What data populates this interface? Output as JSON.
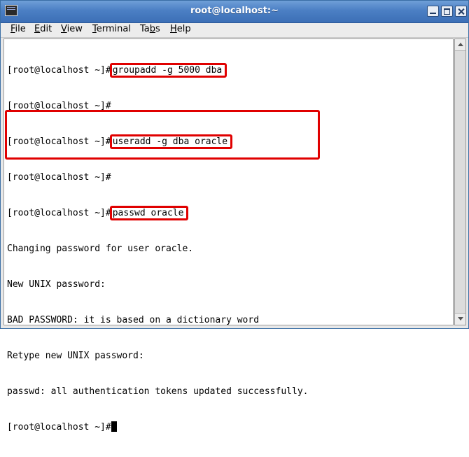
{
  "window": {
    "title": "root@localhost:~"
  },
  "menu": [
    {
      "pre": "",
      "mn": "F",
      "post": "ile"
    },
    {
      "pre": "",
      "mn": "E",
      "post": "dit"
    },
    {
      "pre": "",
      "mn": "V",
      "post": "iew"
    },
    {
      "pre": "",
      "mn": "T",
      "post": "erminal"
    },
    {
      "pre": "Ta",
      "mn": "b",
      "post": "s"
    },
    {
      "pre": "",
      "mn": "H",
      "post": "elp"
    }
  ],
  "terminal": {
    "prompt": "[root@localhost ~]#",
    "commands": {
      "groupadd": "groupadd -g 5000 dba",
      "useradd": "useradd -g dba oracle",
      "passwd": "passwd oracle"
    },
    "output": {
      "changing": "Changing password for user oracle.",
      "new_pw": "New UNIX password:",
      "bad_pw": "BAD PASSWORD: it is based on a dictionary word",
      "retype": "Retype new UNIX password:",
      "updated": "passwd: all authentication tokens updated successfully."
    }
  },
  "colors": {
    "highlight": "#e00000",
    "titlebar": "#4b7fc4"
  }
}
